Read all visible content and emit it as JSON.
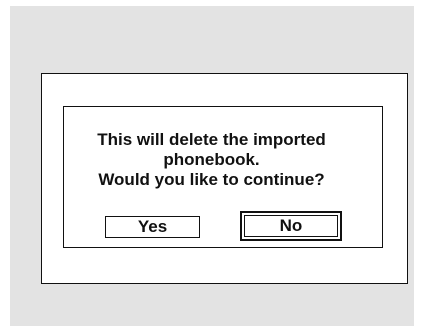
{
  "dialog": {
    "message_lines": [
      "This will delete the imported",
      "phonebook.",
      "Would you like to continue?"
    ],
    "yes_label": "Yes",
    "no_label": "No",
    "focused_button": "No"
  }
}
